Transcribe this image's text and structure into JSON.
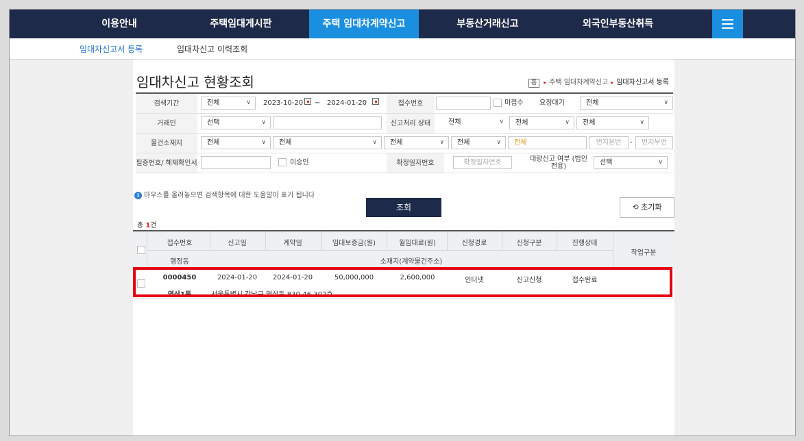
{
  "nav": {
    "items": [
      "이용안내",
      "주택임대게시판",
      "주택 임대차계약신고",
      "부동산거래신고",
      "외국인부동산취득"
    ],
    "active_index": 2,
    "menu_icon": "hamburger-icon"
  },
  "subnav": {
    "items": [
      "임대차신고서 등록",
      "임대차신고 이력조회"
    ],
    "active_index": 0
  },
  "page": {
    "title": "임대차신고 현황조회",
    "breadcrumb": {
      "home": "홈",
      "level1": "주택 임대차계약신고",
      "level2": "임대차신고서 등록"
    }
  },
  "search": {
    "period_label": "검색기간",
    "period_type": "전체",
    "date_from": "2023-10-20",
    "date_sep": "~",
    "date_to": "2024-01-20",
    "receipt_no_label": "접수번호",
    "unreceived_label": "미접수",
    "request_wait_label": "요청대기",
    "request_wait_value": "전체",
    "party_label": "거래인",
    "party_value": "선택",
    "process_status_label": "신고처리 상태",
    "process_status_1": "전체",
    "process_status_2": "전체",
    "process_status_3": "전체",
    "location_label": "물건소재지",
    "loc_sido": "전체",
    "loc_sigungu": "전체",
    "loc_dong": "전체",
    "loc_ri": "전체",
    "loc_type": "전체",
    "bonbun_placeholder": "번지본번",
    "dash": "-",
    "bubun_placeholder": "번지부번",
    "cert_label": "필증번호/ 해제확인서",
    "unapproved_label": "미승인",
    "confirm_date_no_label": "확정일자번호",
    "confirm_date_no_placeholder": "확정일자번호",
    "bulk_report_label": "대량신고 여부 (법인전용)",
    "bulk_report_value": "선택",
    "help_text": "마우스를 올려놓으면 검색항목에 대한 도움말이 표기 됩니다",
    "search_button": "조회",
    "reset_button": "초기화",
    "reset_icon": "refresh-icon"
  },
  "results": {
    "total_prefix": "총",
    "total_count": "1",
    "total_suffix": "건",
    "headers_row1": [
      "접수번호",
      "신고일",
      "계약일",
      "임대보증금(원)",
      "월임대료(원)",
      "신청경로",
      "신청구분",
      "진행상태"
    ],
    "header_dong": "행정동",
    "header_address": "소재지(계약물건주소)",
    "header_work": "작업구분",
    "rows": [
      {
        "receipt_no": "0000450",
        "report_date": "2024-01-20",
        "contract_date": "2024-01-20",
        "deposit": "50,000,000",
        "monthly_rent": "2,600,000",
        "channel": "인터넷",
        "request_type": "신고신청",
        "status": "접수완료",
        "dong": "역삼1동",
        "address": "서울특별시 강남구 역삼동 830-46 302호"
      }
    ]
  },
  "colors": {
    "nav_bg": "#1e2a4a",
    "nav_active": "#1a8fe0",
    "highlight": "#e60012"
  }
}
